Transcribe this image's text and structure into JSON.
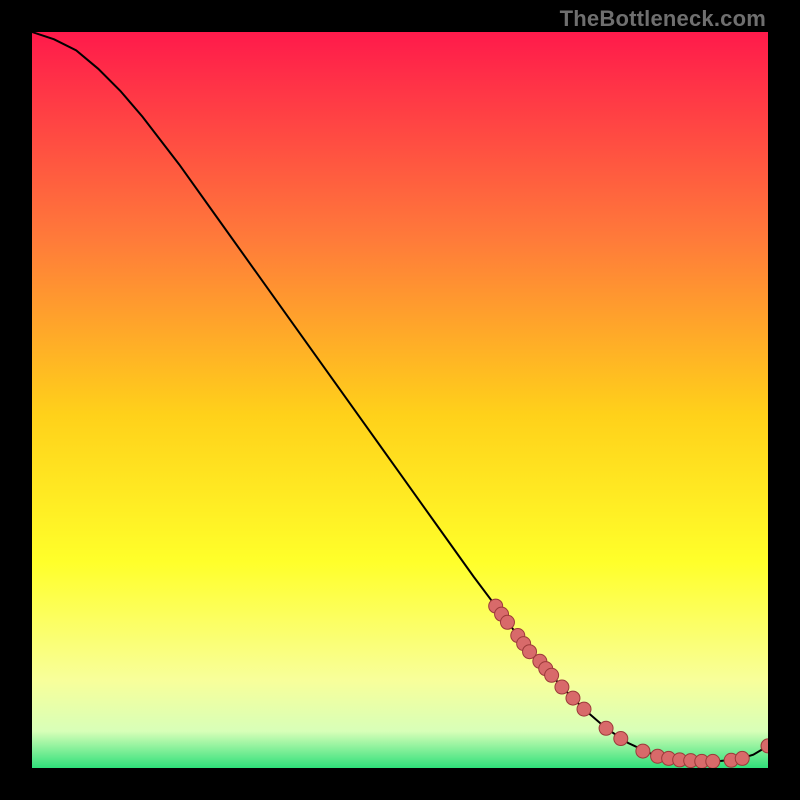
{
  "watermark": "TheBottleneck.com",
  "chart_data": {
    "type": "line",
    "title": "",
    "xlabel": "",
    "ylabel": "",
    "xlim": [
      0,
      100
    ],
    "ylim": [
      0,
      100
    ],
    "curve": {
      "x": [
        0,
        3,
        6,
        9,
        12,
        15,
        20,
        25,
        30,
        35,
        40,
        45,
        50,
        55,
        60,
        63,
        66,
        69,
        72,
        75,
        78,
        81,
        84,
        87,
        90,
        93,
        96,
        98,
        100
      ],
      "y": [
        100,
        99,
        97.5,
        95,
        92,
        88.5,
        82,
        75,
        68,
        61,
        54,
        47,
        40,
        33,
        26,
        22,
        18,
        14.5,
        11,
        8,
        5.4,
        3.4,
        2.0,
        1.2,
        0.9,
        0.9,
        1.2,
        1.8,
        3.0
      ]
    },
    "markers": [
      {
        "x": 63.0,
        "y": 22.0
      },
      {
        "x": 63.8,
        "y": 20.9
      },
      {
        "x": 64.6,
        "y": 19.8
      },
      {
        "x": 66.0,
        "y": 18.0
      },
      {
        "x": 66.8,
        "y": 16.9
      },
      {
        "x": 67.6,
        "y": 15.8
      },
      {
        "x": 69.0,
        "y": 14.5
      },
      {
        "x": 69.8,
        "y": 13.5
      },
      {
        "x": 70.6,
        "y": 12.6
      },
      {
        "x": 72.0,
        "y": 11.0
      },
      {
        "x": 73.5,
        "y": 9.5
      },
      {
        "x": 75.0,
        "y": 8.0
      },
      {
        "x": 78.0,
        "y": 5.4
      },
      {
        "x": 80.0,
        "y": 4.0
      },
      {
        "x": 83.0,
        "y": 2.3
      },
      {
        "x": 85.0,
        "y": 1.6
      },
      {
        "x": 86.5,
        "y": 1.3
      },
      {
        "x": 88.0,
        "y": 1.1
      },
      {
        "x": 89.5,
        "y": 1.0
      },
      {
        "x": 91.0,
        "y": 0.9
      },
      {
        "x": 92.5,
        "y": 0.9
      },
      {
        "x": 95.0,
        "y": 1.05
      },
      {
        "x": 96.5,
        "y": 1.3
      },
      {
        "x": 100.0,
        "y": 3.0
      }
    ],
    "colors": {
      "line": "#000000",
      "marker_fill": "#d86a6a",
      "marker_stroke": "#9c3a3a",
      "gradient_top": "#ff1a4b",
      "gradient_mid_upper": "#ff7a3a",
      "gradient_mid": "#ffd11a",
      "gradient_mid_lower": "#ffff2a",
      "gradient_low": "#f8ff9a",
      "gradient_bottom_soft": "#d8ffb8",
      "gradient_bottom": "#2fe07a"
    }
  }
}
